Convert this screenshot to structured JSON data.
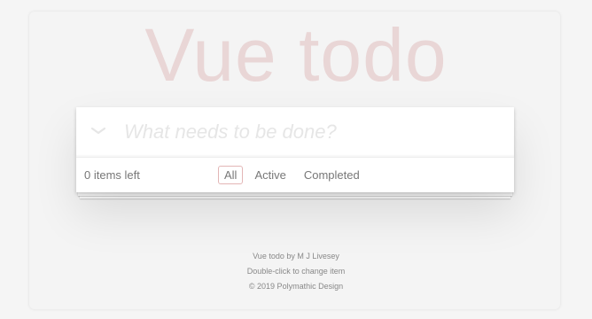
{
  "app": {
    "title": "Vue todo"
  },
  "new_todo": {
    "placeholder": "What needs to be done?",
    "value": ""
  },
  "footer": {
    "items_left": "0 items left",
    "filters": [
      {
        "label": "All",
        "selected": true
      },
      {
        "label": "Active",
        "selected": false
      },
      {
        "label": "Completed",
        "selected": false
      }
    ]
  },
  "info": {
    "credit": "Vue todo by M J Livesey",
    "hint": "Double-click to change item",
    "copyright": "© 2019 Polymathic Design"
  },
  "colors": {
    "title": "#af2f2f",
    "selected_filter_border": "#af2f2f",
    "text": "#777777",
    "placeholder": "#e6e6e6"
  },
  "icons": {
    "toggle_all": "chevron-down-icon"
  }
}
